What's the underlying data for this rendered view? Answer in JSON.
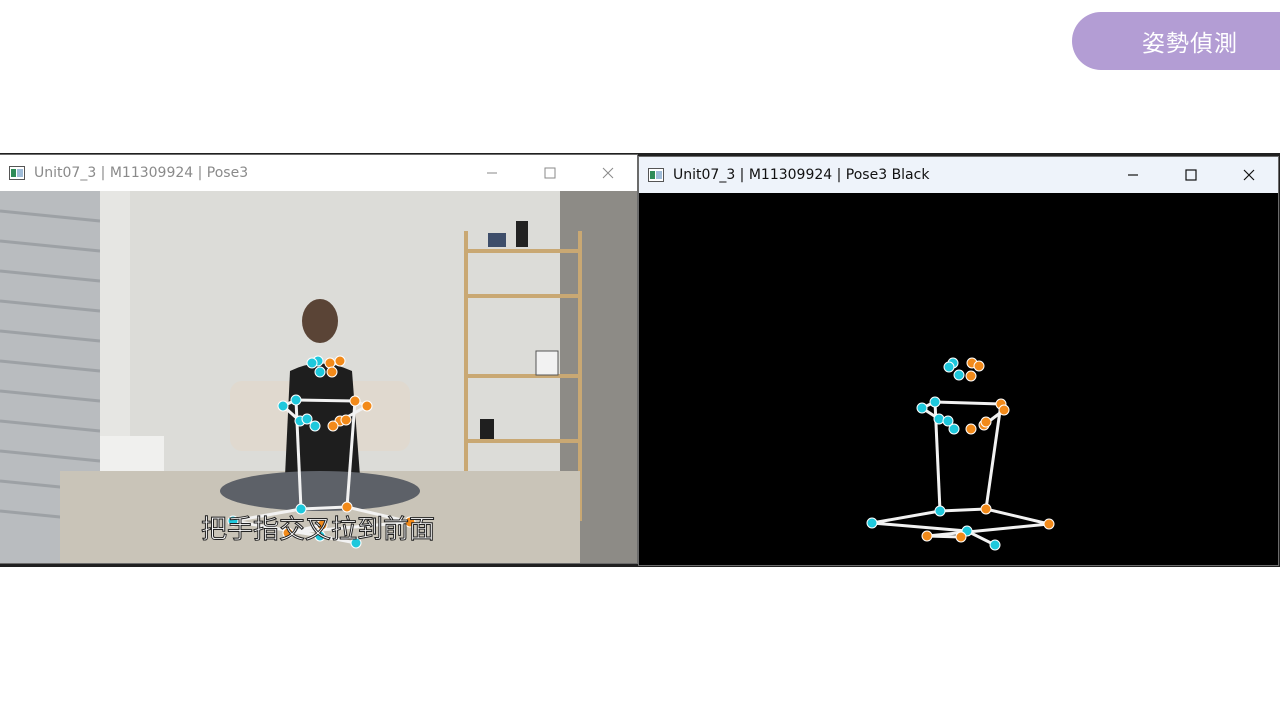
{
  "badge": {
    "label": "姿勢偵測"
  },
  "windows": [
    {
      "title": "Unit07_3 | M11309924 | Pose3",
      "subtitle_caption": "把手指交叉拉到前面"
    },
    {
      "title": "Unit07_3 | M11309924 | Pose3 Black"
    }
  ],
  "colors": {
    "left_keypoint": "#1ec8dc",
    "right_keypoint": "#f28a1a",
    "skeleton": "#f2f2f2",
    "badge": "#b39dd4"
  },
  "icons": {
    "minimize": "minimize-icon",
    "maximize": "maximize-icon",
    "close": "close-icon",
    "app": "app-window-icon"
  }
}
